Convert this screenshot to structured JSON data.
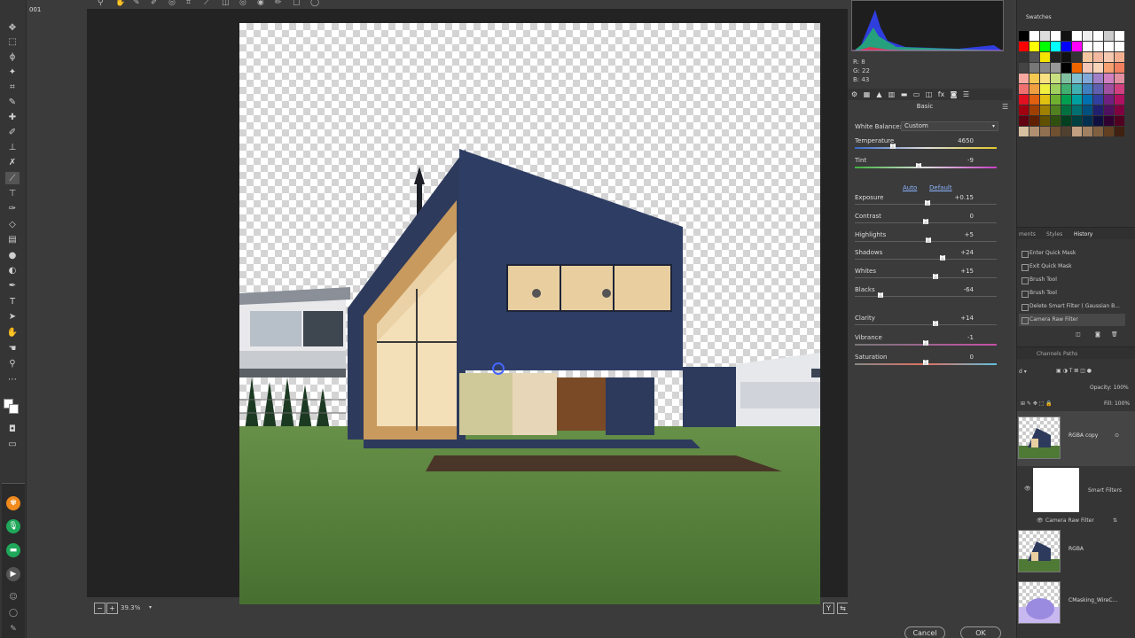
{
  "app": {
    "version_label": "001"
  },
  "canvas": {
    "zoom": "39.3%"
  },
  "histogram": {
    "r_label": "R:",
    "r": "8",
    "g_label": "G:",
    "g": "22",
    "b_label": "B:",
    "b": "43"
  },
  "panel": {
    "title": "Basic",
    "white_balance": {
      "label": "White Balance:",
      "value": "Custom"
    },
    "auto_label": "Auto",
    "default_label": "Default",
    "sliders": [
      {
        "label": "Temperature",
        "value": "4650",
        "position": 0.27,
        "bar": "temp"
      },
      {
        "label": "Tint",
        "value": "-9",
        "position": 0.45,
        "bar": "tint"
      },
      {
        "label": "Exposure",
        "value": "+0.15",
        "position": 0.51,
        "bar": ""
      },
      {
        "label": "Contrast",
        "value": "0",
        "position": 0.5,
        "bar": ""
      },
      {
        "label": "Highlights",
        "value": "+5",
        "position": 0.52,
        "bar": ""
      },
      {
        "label": "Shadows",
        "value": "+24",
        "position": 0.62,
        "bar": ""
      },
      {
        "label": "Whites",
        "value": "+15",
        "position": 0.57,
        "bar": ""
      },
      {
        "label": "Blacks",
        "value": "-64",
        "position": 0.18,
        "bar": ""
      },
      {
        "label": "Clarity",
        "value": "+14",
        "position": 0.57,
        "bar": ""
      },
      {
        "label": "Vibrance",
        "value": "-1",
        "position": 0.5,
        "bar": "vib"
      },
      {
        "label": "Saturation",
        "value": "0",
        "position": 0.5,
        "bar": "sat"
      }
    ]
  },
  "buttons": {
    "cancel": "Cancel",
    "ok": "OK"
  },
  "swatches": {
    "title": "Swatches",
    "colors": [
      "#000000",
      "#ffffff",
      "#dddddd",
      "#ffffff",
      "#111111",
      "#ffffff",
      "#eeeeee",
      "#ffffff",
      "#cccccc",
      "#ffffff",
      "#ff0000",
      "#ffff00",
      "#00ff00",
      "#00ffff",
      "#0000ff",
      "#ff00ff",
      "#ffffff",
      "#ffffff",
      "#ffffff",
      "#ffffff",
      "#333333",
      "#555555",
      "#f5e400",
      "#222222",
      "#111111",
      "#333333",
      "#f4c6a0",
      "#f2b8a0",
      "#f5c9b0",
      "#f3b090",
      "#444444",
      "#777777",
      "#888888",
      "#999999",
      "#000000",
      "#ee6600",
      "#f4c6b6",
      "#f9d3b8",
      "#f5a070",
      "#f08060",
      "#f7a8a0",
      "#f5c850",
      "#f9e080",
      "#c8e080",
      "#80c0a0",
      "#80c0d0",
      "#80a8d8",
      "#a080c8",
      "#d080c0",
      "#e090a0",
      "#f07070",
      "#f0a040",
      "#f0f040",
      "#a0d060",
      "#40b070",
      "#40b0b0",
      "#4080c0",
      "#6060b0",
      "#a050a0",
      "#d04080",
      "#e01020",
      "#e06010",
      "#e0c010",
      "#70b030",
      "#00a050",
      "#00a0a0",
      "#0070b0",
      "#3040a0",
      "#702080",
      "#b01060",
      "#a00010",
      "#a04000",
      "#a08000",
      "#508020",
      "#007040",
      "#007070",
      "#005080",
      "#202070",
      "#501060",
      "#800040",
      "#600010",
      "#602000",
      "#605000",
      "#305010",
      "#004020",
      "#004040",
      "#003050",
      "#101040",
      "#300030",
      "#500020",
      "#d8c0a0",
      "#b09070",
      "#907050",
      "#705030",
      "#504030",
      "#c0a080",
      "#a08060",
      "#806040",
      "#604020",
      "#402010"
    ]
  },
  "history": {
    "tabs": [
      "ments",
      "Styles",
      "History"
    ],
    "items": [
      "Enter Quick Mask",
      "Exit Quick Mask",
      "Brush Tool",
      "Brush Tool",
      "Delete Smart Filter ( Gaussian B...",
      "Camera Raw Filter"
    ]
  },
  "layers": {
    "tabs": [
      "Channels",
      "Paths"
    ],
    "opacity_label": "Opacity:",
    "opacity": "100%",
    "fill_label": "Fill:",
    "fill": "100%",
    "items": [
      "RGBA copy",
      "Smart Filters",
      "Camera Raw Filter",
      "RGBA",
      "CMasking_WireC..."
    ]
  }
}
